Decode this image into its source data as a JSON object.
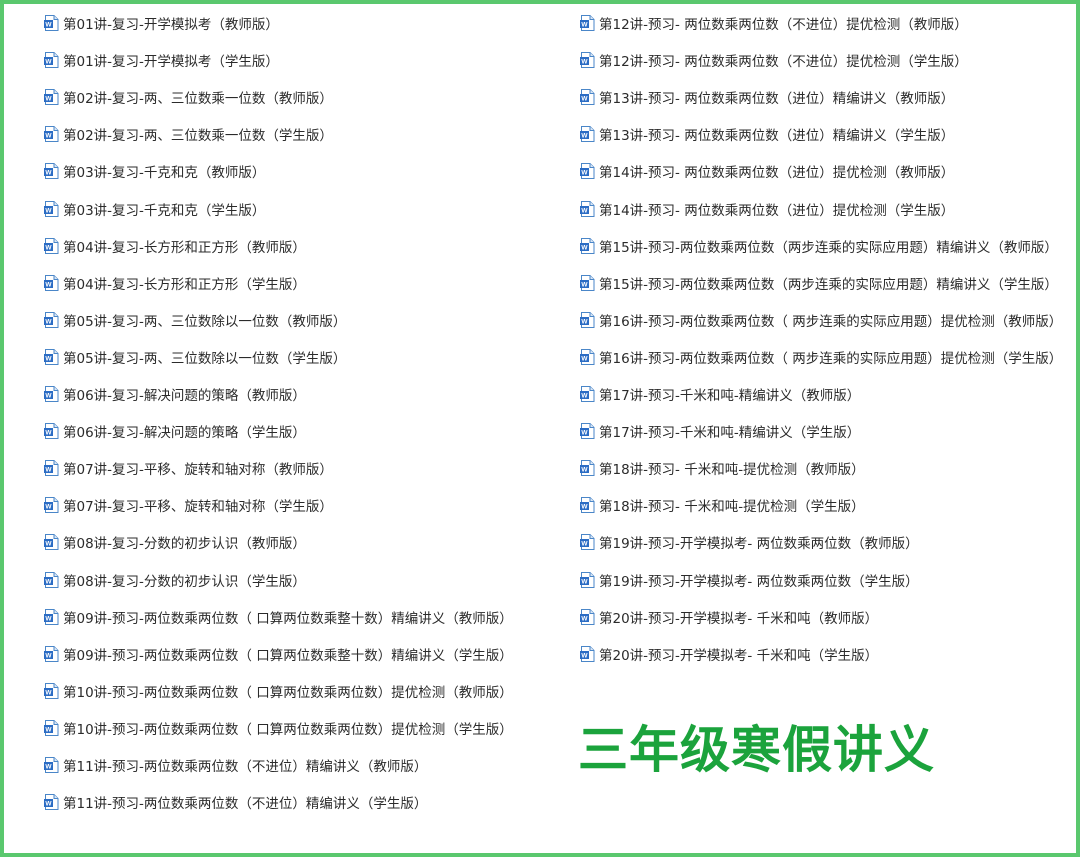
{
  "file_icon": "word-document-icon",
  "accent_color": "#1ba33c",
  "border_color": "#5ac86e",
  "left_column": [
    "第01讲-复习-开学模拟考（教师版）",
    "第01讲-复习-开学模拟考（学生版）",
    "第02讲-复习-两、三位数乘一位数（教师版）",
    "第02讲-复习-两、三位数乘一位数（学生版）",
    "第03讲-复习-千克和克（教师版）",
    "第03讲-复习-千克和克（学生版）",
    "第04讲-复习-长方形和正方形（教师版）",
    "第04讲-复习-长方形和正方形（学生版）",
    "第05讲-复习-两、三位数除以一位数（教师版）",
    "第05讲-复习-两、三位数除以一位数（学生版）",
    "第06讲-复习-解决问题的策略（教师版）",
    "第06讲-复习-解决问题的策略（学生版）",
    "第07讲-复习-平移、旋转和轴对称（教师版）",
    "第07讲-复习-平移、旋转和轴对称（学生版）",
    "第08讲-复习-分数的初步认识（教师版）",
    "第08讲-复习-分数的初步认识（学生版）",
    "第09讲-预习-两位数乘两位数（ 口算两位数乘整十数）精编讲义（教师版）",
    "第09讲-预习-两位数乘两位数（ 口算两位数乘整十数）精编讲义（学生版）",
    "第10讲-预习-两位数乘两位数（ 口算两位数乘两位数）提优检测（教师版）",
    "第10讲-预习-两位数乘两位数（ 口算两位数乘两位数）提优检测（学生版）",
    "第11讲-预习-两位数乘两位数（不进位）精编讲义（教师版）",
    "第11讲-预习-两位数乘两位数（不进位）精编讲义（学生版）"
  ],
  "right_column": [
    "第12讲-预习- 两位数乘两位数（不进位）提优检测（教师版）",
    "第12讲-预习- 两位数乘两位数（不进位）提优检测（学生版）",
    "第13讲-预习- 两位数乘两位数（进位）精编讲义（教师版）",
    "第13讲-预习- 两位数乘两位数（进位）精编讲义（学生版）",
    "第14讲-预习- 两位数乘两位数（进位）提优检测（教师版）",
    "第14讲-预习- 两位数乘两位数（进位）提优检测（学生版）",
    "第15讲-预习-两位数乘两位数（两步连乘的实际应用题）精编讲义（教师版）",
    "第15讲-预习-两位数乘两位数（两步连乘的实际应用题）精编讲义（学生版）",
    "第16讲-预习-两位数乘两位数（ 两步连乘的实际应用题）提优检测（教师版）",
    "第16讲-预习-两位数乘两位数（ 两步连乘的实际应用题）提优检测（学生版）",
    "第17讲-预习-千米和吨-精编讲义（教师版）",
    "第17讲-预习-千米和吨-精编讲义（学生版）",
    "第18讲-预习- 千米和吨-提优检测（教师版）",
    "第18讲-预习- 千米和吨-提优检测（学生版）",
    "第19讲-预习-开学模拟考- 两位数乘两位数（教师版）",
    "第19讲-预习-开学模拟考- 两位数乘两位数（学生版）",
    "第20讲-预习-开学模拟考- 千米和吨（教师版）",
    "第20讲-预习-开学模拟考- 千米和吨（学生版）"
  ],
  "watermark_title": "三年级寒假讲义"
}
